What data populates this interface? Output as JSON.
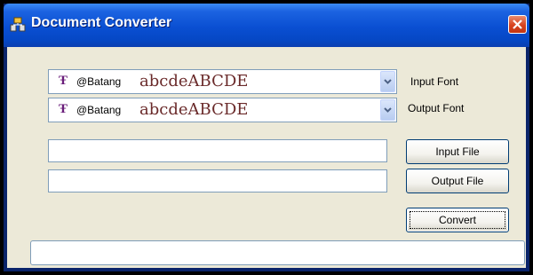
{
  "window": {
    "title": "Document Converter",
    "icons": {
      "app": "document-converter-icon",
      "close": "close-icon"
    },
    "colors": {
      "titlebar": "#0a4fd2",
      "client": "#ece9d8",
      "close": "#d8421e"
    }
  },
  "input_font": {
    "label": "Input Font",
    "font_icon": "truetype-font-icon",
    "font_name": "@Batang",
    "sample": "abcdeABCDE"
  },
  "output_font": {
    "label": "Output Font",
    "font_icon": "truetype-font-icon",
    "font_name": "@Batang",
    "sample": "abcdeABCDE"
  },
  "input_file": {
    "value": "",
    "button_label": "Input File"
  },
  "output_file": {
    "value": "",
    "button_label": "Output File"
  },
  "convert": {
    "label": "Convert"
  },
  "status": {
    "text": ""
  }
}
